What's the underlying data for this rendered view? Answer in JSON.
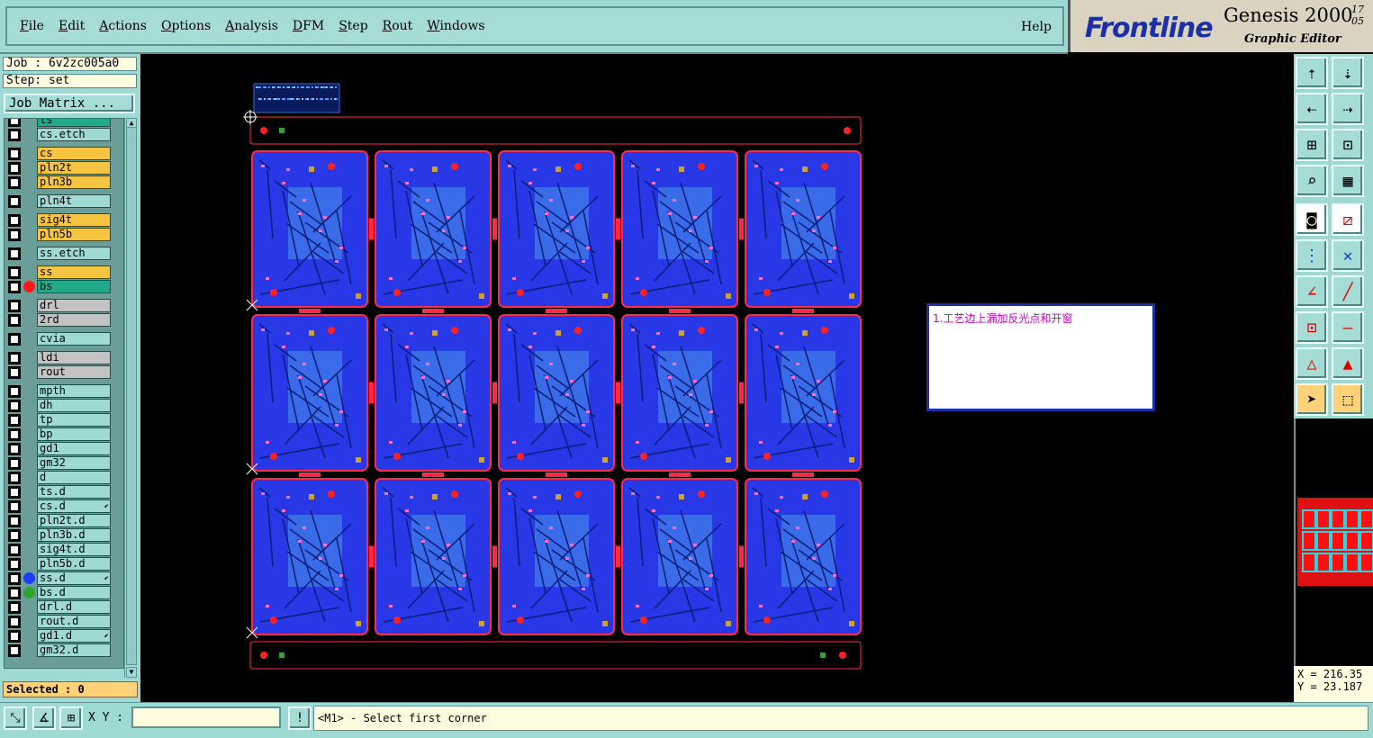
{
  "menu": {
    "items": [
      "File",
      "Edit",
      "Actions",
      "Options",
      "Analysis",
      "DFM",
      "Step",
      "Rout",
      "Windows"
    ],
    "help": "Help"
  },
  "brand": {
    "logo": "Frontline",
    "title": "Genesis 2000",
    "subtitle": "Graphic Editor",
    "version_top": "17",
    "version_bottom": "05"
  },
  "panel": {
    "job": "Job : 6v2zc005a0",
    "step": "Step: set",
    "job_matrix_button": "Job Matrix ...",
    "selected": "Selected : 0"
  },
  "layers": [
    {
      "name": "ts",
      "color": "#22a98a"
    },
    {
      "name": "cs.etch",
      "color": "#9fd9d3"
    },
    {
      "name": "cs",
      "color": "#f5c542"
    },
    {
      "name": "pln2t",
      "color": "#f5c542"
    },
    {
      "name": "pln3b",
      "color": "#f5c542"
    },
    {
      "name": "pln4t",
      "color": "#9fd9d3"
    },
    {
      "name": "sig4t",
      "color": "#f5c542"
    },
    {
      "name": "pln5b",
      "color": "#f5c542"
    },
    {
      "name": "ss.etch",
      "color": "#9fd9d3"
    },
    {
      "name": "ss",
      "color": "#f5c542"
    },
    {
      "name": "bs",
      "color": "#22a98a",
      "dot": "#ff1a1a"
    },
    {
      "name": "drl",
      "color": "#c3c3c3"
    },
    {
      "name": "2rd",
      "color": "#c3c3c3"
    },
    {
      "name": "cvia",
      "color": "#9fd9d3"
    },
    {
      "name": "ldi",
      "color": "#c3c3c3"
    },
    {
      "name": "rout",
      "color": "#c3c3c3"
    },
    {
      "name": "mpth",
      "color": "#9fd9d3"
    },
    {
      "name": "dh",
      "color": "#9fd9d3"
    },
    {
      "name": "tp",
      "color": "#9fd9d3"
    },
    {
      "name": "bp",
      "color": "#9fd9d3"
    },
    {
      "name": "gd1",
      "color": "#9fd9d3"
    },
    {
      "name": "gm32",
      "color": "#9fd9d3"
    },
    {
      "name": "d",
      "color": "#9fd9d3"
    },
    {
      "name": "ts.d",
      "color": "#9fd9d3"
    },
    {
      "name": "cs.d",
      "color": "#9fd9d3",
      "mark": true
    },
    {
      "name": "pln2t.d",
      "color": "#9fd9d3"
    },
    {
      "name": "pln3b.d",
      "color": "#9fd9d3"
    },
    {
      "name": "sig4t.d",
      "color": "#9fd9d3"
    },
    {
      "name": "pln5b.d",
      "color": "#9fd9d3"
    },
    {
      "name": "ss.d",
      "color": "#9fd9d3",
      "dot": "#1a3cff",
      "mark": true
    },
    {
      "name": "bs.d",
      "color": "#9fd9d3",
      "dot": "#2fa52f"
    },
    {
      "name": "drl.d",
      "color": "#9fd9d3"
    },
    {
      "name": "rout.d",
      "color": "#9fd9d3"
    },
    {
      "name": "gd1.d",
      "color": "#9fd9d3",
      "mark": true
    },
    {
      "name": "gm32.d",
      "color": "#9fd9d3"
    }
  ],
  "board": {
    "columns": 5,
    "rows": 3,
    "board_color": "#2838e6",
    "outline_color": "#ff2a4a"
  },
  "note": {
    "text": "1.工艺边上漏加反光点和开窗"
  },
  "coords": {
    "x": "X = 216.35",
    "y": "Y = 23.187"
  },
  "bottom": {
    "xy_label": "X Y :",
    "xy_value": "",
    "message": "<M1> - Select first corner"
  }
}
